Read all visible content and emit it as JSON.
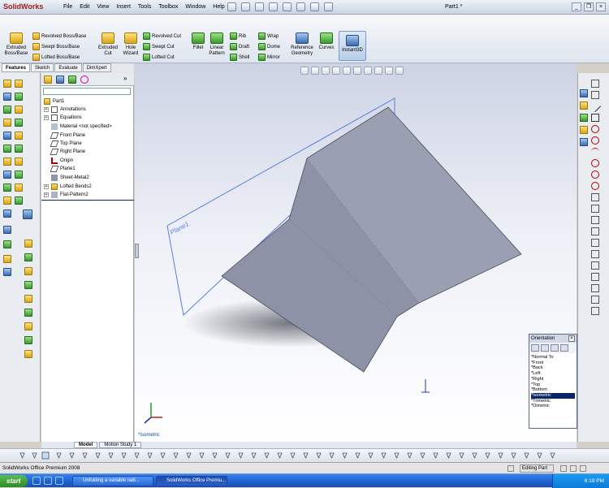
{
  "app": {
    "logo": "SolidWorks",
    "doc_title": "Part1 *",
    "menus": [
      "File",
      "Edit",
      "View",
      "Insert",
      "Tools",
      "Toolbox",
      "Window",
      "Help"
    ]
  },
  "ribbon": {
    "extruded_boss": "Extruded Boss/Base",
    "revolved_boss": "Revolved Boss/Base",
    "swept_boss": "Swept Boss/Base",
    "lofted_boss": "Lofted Boss/Base",
    "extruded_cut": "Extruded Cut",
    "hole_wizard": "Hole Wizard",
    "revolved_cut": "Revolved Cut",
    "swept_cut": "Swept Cut",
    "lofted_cut": "Lofted Cut",
    "fillet": "Fillet",
    "linear_pattern": "Linear Pattern",
    "rib": "Rib",
    "draft": "Draft",
    "shell": "Shell",
    "wrap": "Wrap",
    "dome": "Dome",
    "mirror": "Mirror",
    "reference_geometry": "Reference Geometry",
    "curves": "Curves",
    "instant3d": "Instant3D"
  },
  "command_tabs": [
    "Features",
    "Sketch",
    "Evaluate",
    "DimXpert"
  ],
  "tree": {
    "items": [
      "Part1",
      "Annotations",
      "Equations",
      "Material <not specified>",
      "Front Plane",
      "Top Plane",
      "Right Plane",
      "Origin",
      "Plane1",
      "Sheet-Metal2",
      "Lofted Bends2",
      "Flat-Pattern2"
    ]
  },
  "viewport": {
    "plane_label": "Plane1",
    "view_label": "*Isometric"
  },
  "orientation": {
    "title": "Orientation",
    "close": "×",
    "items": [
      "*Normal To",
      "*Front",
      "*Back",
      "*Left",
      "*Right",
      "*Top",
      "*Bottom",
      "*Isometric",
      "*Trimetric",
      "*Dimetric"
    ],
    "selected": "*Isometric"
  },
  "bottom_tabs": [
    "Model",
    "Motion Study 1"
  ],
  "status": {
    "text": "SolidWorks Office Premium 2008",
    "mode": "Editing Part"
  },
  "taskbar": {
    "start": "start",
    "tasks": [
      "Unfolding a variable radi...",
      "SolidWorks Office Premiu..."
    ],
    "clock": "6:19 PM"
  }
}
